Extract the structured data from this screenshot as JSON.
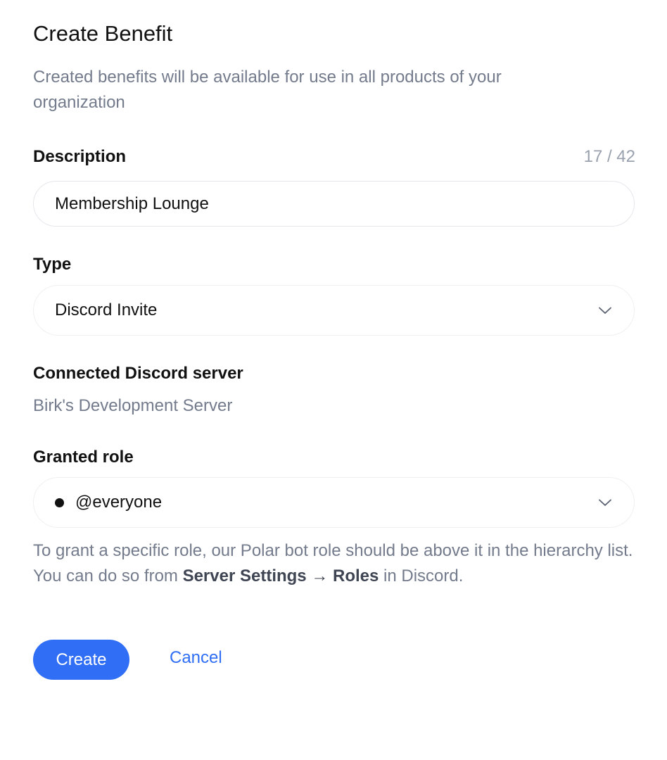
{
  "dialog": {
    "title": "Create Benefit",
    "subtitle": "Created benefits will be available for use in all products of your organization"
  },
  "description": {
    "label": "Description",
    "counter": "17 / 42",
    "value": "Membership Lounge"
  },
  "type": {
    "label": "Type",
    "selected": "Discord Invite",
    "icon": "chevron-down-icon"
  },
  "server": {
    "label": "Connected Discord server",
    "name": "Birk's Development Server"
  },
  "role": {
    "label": "Granted role",
    "selected": "@everyone",
    "icon": "chevron-down-icon"
  },
  "hint": {
    "text_1": "To grant a specific role, our Polar bot role should be above it in the hierarchy list. You can do so from ",
    "bold_1": "Server Settings",
    "arrow": " → ",
    "bold_2": "Roles",
    "text_2": " in Discord."
  },
  "actions": {
    "create_label": "Create",
    "cancel_label": "Cancel"
  },
  "colors": {
    "accent": "#2f6ef5",
    "muted_text": "#737b8c",
    "border": "#e6e7eb"
  }
}
